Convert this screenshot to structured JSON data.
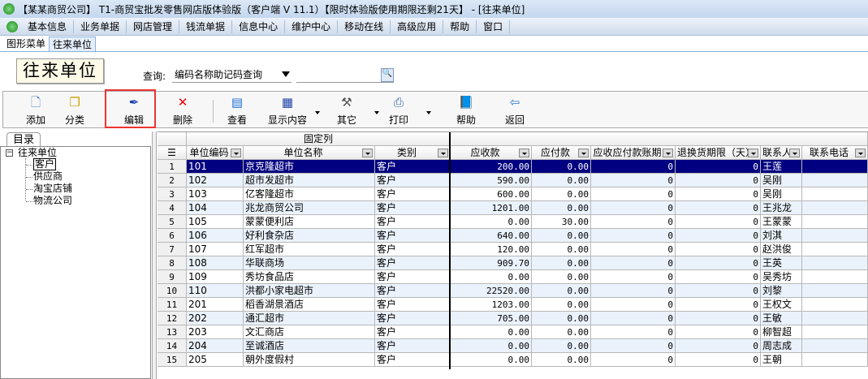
{
  "window": {
    "title": "【某某商贸公司】 T1-商贸宝批发零售网店版体验版（客户端 V 11.1）【限时体验版使用期限还剩21天】 - [往来单位]"
  },
  "menu": [
    "基本信息",
    "业务单据",
    "网店管理",
    "钱流单据",
    "信息中心",
    "维护中心",
    "移动在线",
    "高级应用",
    "帮助",
    "窗口"
  ],
  "tabs": [
    {
      "label": "图形菜单",
      "active": false
    },
    {
      "label": "往来单位",
      "active": true
    }
  ],
  "logo": "往来单位",
  "query": {
    "label": "查询:",
    "selected": "编码名称助记码查询",
    "value": ""
  },
  "toolbar": [
    {
      "label": "添加",
      "icon": "new-document-icon"
    },
    {
      "label": "分类",
      "icon": "copy-documents-icon"
    },
    {
      "label": "编辑",
      "icon": "pen-icon",
      "highlighted": true
    },
    {
      "label": "删除",
      "icon": "red-x-icon"
    },
    {
      "label": "查看",
      "icon": "notepad-icon"
    },
    {
      "label": "显示内容",
      "icon": "grid-icon",
      "dropdown": true
    },
    {
      "label": "其它",
      "icon": "hammer-icon",
      "dropdown": true
    },
    {
      "label": "打印",
      "icon": "printer-icon",
      "dropdown": true
    },
    {
      "label": "帮助",
      "icon": "help-book-icon"
    },
    {
      "label": "返回",
      "icon": "exit-door-icon"
    }
  ],
  "tree": {
    "tab": "目录",
    "root": "往来单位",
    "children": [
      "客户",
      "供应商",
      "淘宝店铺",
      "物流公司"
    ],
    "selected": "客户"
  },
  "grid": {
    "fixed_label": "固定列",
    "columns": [
      "单位编码",
      "单位名称",
      "类别",
      "应收款",
      "应付款",
      "应收应付款账期",
      "退换货期限（天）",
      "联系人",
      "联系电话"
    ],
    "rows": [
      [
        "101",
        "京克隆超市",
        "客户",
        "200.00",
        "0.00",
        "0",
        "0",
        "王莲",
        ""
      ],
      [
        "102",
        "超市发超市",
        "客户",
        "590.00",
        "0.00",
        "0",
        "0",
        "吴刚",
        ""
      ],
      [
        "103",
        "亿客隆超市",
        "客户",
        "600.00",
        "0.00",
        "0",
        "0",
        "吴刚",
        ""
      ],
      [
        "104",
        "兆龙商贸公司",
        "客户",
        "1201.00",
        "0.00",
        "0",
        "0",
        "王兆龙",
        ""
      ],
      [
        "105",
        "蒙蒙便利店",
        "客户",
        "0.00",
        "30.00",
        "0",
        "0",
        "王蒙蒙",
        ""
      ],
      [
        "106",
        "好利食杂店",
        "客户",
        "640.00",
        "0.00",
        "0",
        "0",
        "刘淇",
        ""
      ],
      [
        "107",
        "红军超市",
        "客户",
        "120.00",
        "0.00",
        "0",
        "0",
        "赵洪俊",
        ""
      ],
      [
        "108",
        "华联商场",
        "客户",
        "909.70",
        "0.00",
        "0",
        "0",
        "王英",
        ""
      ],
      [
        "109",
        "秀坊食品店",
        "客户",
        "0.00",
        "0.00",
        "0",
        "0",
        "吴秀坊",
        ""
      ],
      [
        "110",
        "洪都小家电超市",
        "客户",
        "22520.00",
        "0.00",
        "0",
        "0",
        "刘黎",
        ""
      ],
      [
        "201",
        "稻香湖景酒店",
        "客户",
        "1203.00",
        "0.00",
        "0",
        "0",
        "王权文",
        ""
      ],
      [
        "202",
        "通汇超市",
        "客户",
        "705.00",
        "0.00",
        "0",
        "0",
        "王敏",
        ""
      ],
      [
        "203",
        "文汇商店",
        "客户",
        "0.00",
        "0.00",
        "0",
        "0",
        "柳智超",
        ""
      ],
      [
        "204",
        "至诚酒店",
        "客户",
        "0.00",
        "0.00",
        "0",
        "0",
        "周志成",
        ""
      ],
      [
        "205",
        "朝外度假村",
        "客户",
        "0.00",
        "0.00",
        "0",
        "0",
        "王朝",
        ""
      ]
    ],
    "selected_row": 1
  },
  "colors": {
    "selected_row": "#000080",
    "alt_row": "#eaf2fc",
    "highlight_box": "#e33333"
  }
}
